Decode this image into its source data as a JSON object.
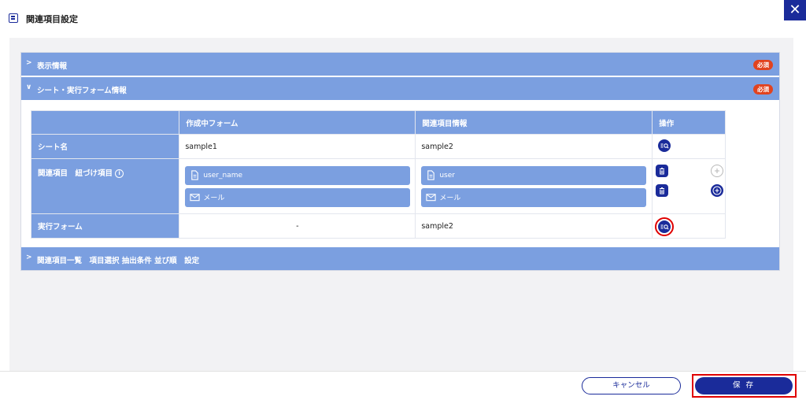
{
  "header": {
    "title": "関連項目設定",
    "close_label": "✕"
  },
  "sections": {
    "display": {
      "label": "表示情報",
      "badge": "必須",
      "chevron": ">"
    },
    "sheet": {
      "label": "シート・実行フォーム情報",
      "badge": "必須",
      "chevron": "∨"
    },
    "related_list": {
      "label": "関連項目一覧　項目選択 抽出条件 並び順　設定",
      "chevron": ">"
    }
  },
  "table": {
    "headers": [
      "",
      "作成中フォーム",
      "関連項目情報",
      "操作"
    ],
    "rows": {
      "sheet_name": {
        "label": "シート名",
        "current": "sample1",
        "related": "sample2"
      },
      "related_items": {
        "label": "関連項目　紐づけ項目",
        "info": "i",
        "current": [
          {
            "icon": "document-icon",
            "text": "user_name"
          },
          {
            "icon": "mail-icon",
            "text": "メール"
          }
        ],
        "related": [
          {
            "icon": "document-icon",
            "text": "user"
          },
          {
            "icon": "mail-icon",
            "text": "メール"
          }
        ]
      },
      "exec_form": {
        "label": "実行フォーム",
        "current": "-",
        "related": "sample2"
      }
    }
  },
  "footer": {
    "cancel_label": "キャンセル",
    "save_label": "保 存"
  },
  "colors": {
    "brand": "#1a2b9a",
    "section": "#7b9fe0",
    "badge": "#e1431f",
    "highlight": "#e00000"
  }
}
